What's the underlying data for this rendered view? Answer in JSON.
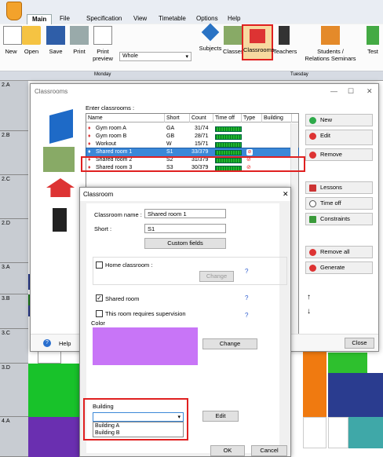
{
  "tabs": [
    "Main",
    "File",
    "Specification",
    "View",
    "Timetable",
    "Options",
    "Help"
  ],
  "ribbon": {
    "buttons": [
      "New",
      "Open",
      "Save",
      "Print",
      "Print preview",
      "Subjects",
      "Classes",
      "Classrooms",
      "Teachers",
      "Students / Relations Seminars",
      "Test"
    ],
    "combo": "Whole"
  },
  "timetable": {
    "days": [
      "Monday",
      "Tuesday"
    ],
    "rows": [
      "2.A",
      "2.B",
      "2.C",
      "2.D",
      "3.A",
      "3.B",
      "3.C",
      "3.D",
      "4.A"
    ]
  },
  "classrooms": {
    "title": "Classrooms",
    "enter_label": "Enter classrooms :",
    "columns": [
      "Name",
      "Short",
      "Count",
      "Time off",
      "Type",
      "Building"
    ],
    "rows": [
      {
        "name": "Gym room A",
        "short": "GA",
        "count": "31/74"
      },
      {
        "name": "Gym room B",
        "short": "GB",
        "count": "28/71"
      },
      {
        "name": "Workout",
        "short": "W",
        "count": "15/71"
      },
      {
        "name": "Shared room 1",
        "short": "S1",
        "count": "33/379"
      },
      {
        "name": "Shared room 2",
        "short": "S2",
        "count": "31/379"
      },
      {
        "name": "Shared room 3",
        "short": "S3",
        "count": "30/379"
      }
    ],
    "side_buttons": [
      "New",
      "Edit",
      "Remove",
      "Lessons",
      "Time off",
      "Constraints",
      "Remove all",
      "Generate"
    ],
    "help": "Help",
    "close": "Close"
  },
  "dialog": {
    "title": "Classroom",
    "name_label": "Classroom name :",
    "name_value": "Shared room 1",
    "short_label": "Short :",
    "short_value": "S1",
    "custom_fields": "Custom fields",
    "home_label": "Home classroom :",
    "change": "Change",
    "shared_label": "Shared room",
    "supervision_label": "This room requires supervision",
    "color_label": "Color",
    "color_value": "#c875f7",
    "change2": "Change",
    "building_label": "Building",
    "building_options": [
      "Building A",
      "Building B"
    ],
    "edit": "Edit",
    "ok": "OK",
    "cancel": "Cancel"
  },
  "colors": {
    "highlight": "#e02020",
    "selection": "#3b88d8"
  }
}
